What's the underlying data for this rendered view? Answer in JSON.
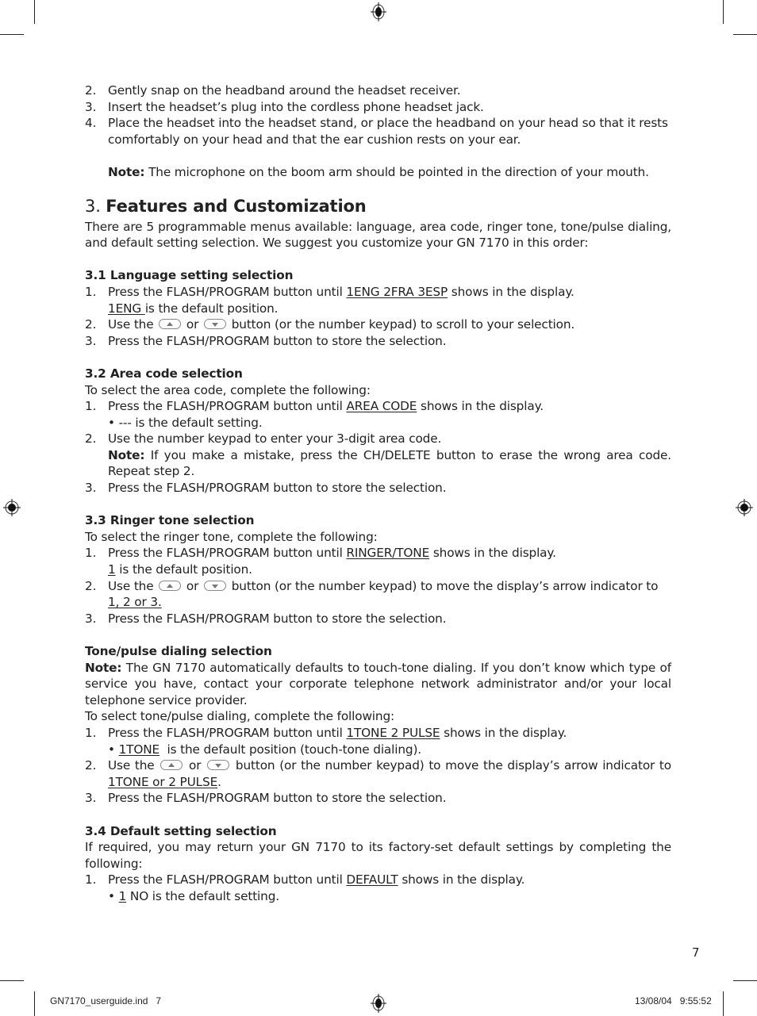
{
  "intro_list": [
    {
      "num": "2.",
      "text": "Gently snap on the headband around the headset receiver."
    },
    {
      "num": "3.",
      "text": "Insert the headset’s plug into the cordless phone headset jack."
    },
    {
      "num": "4.",
      "text": "Place the headset into the headset stand, or place the headband on your head so that it rests comfortably on your head and that the ear cushion rests on your ear."
    }
  ],
  "intro_note": {
    "label": "Note:",
    "text": " The microphone on the boom arm should be pointed in the direction of your mouth."
  },
  "section": {
    "number": "3.",
    "title": "Features and Customization",
    "intro": "There are 5 programmable menus available: language, area code, ringer tone, tone/pulse dialing, and default setting selection. We suggest you customize your GN 7170 in this order:"
  },
  "s31": {
    "title": "3.1 Language setting selection",
    "step1": {
      "num": "1.",
      "pre": "Press the FLASH/PROGRAM button until ",
      "u": "1ENG 2FRA 3ESP",
      "post": " shows in the display."
    },
    "step1_sub": {
      "u": "1ENG ",
      "post": "is the default position."
    },
    "step2": {
      "num": "2.",
      "pre": "Use the ",
      "or": " or ",
      "post": " button (or the number keypad) to scroll to your selection."
    },
    "step3": {
      "num": "3.",
      "text": "Press the FLASH/PROGRAM button to store the selection."
    }
  },
  "s32": {
    "title": "3.2 Area code selection",
    "intro": "To select the area code, complete the following:",
    "step1": {
      "num": "1.",
      "pre": "Press the FLASH/PROGRAM button until ",
      "u": "AREA CODE",
      "post": " shows in the display."
    },
    "step1_sub": "• --- is the default setting.",
    "step2": {
      "num": "2.",
      "text": "Use the number keypad to enter your 3-digit area code."
    },
    "step2_note": {
      "label": "Note:",
      "text": " If you make a mistake, press the CH/DELETE button to erase the wrong area code. Repeat step 2."
    },
    "step3": {
      "num": "3.",
      "text": "Press the FLASH/PROGRAM button to store the selection."
    }
  },
  "s33": {
    "title": "3.3 Ringer tone selection",
    "intro": "To select the ringer tone, complete the following:",
    "step1": {
      "num": "1.",
      "pre": "Press the FLASH/PROGRAM button until ",
      "u": "RINGER/TONE",
      "post": " shows in the display."
    },
    "step1_sub": {
      "u": "1",
      "post": " is the default position."
    },
    "step2": {
      "num": "2.",
      "pre": "Use the ",
      "or": " or ",
      "post": " button (or the number keypad) to move the display’s arrow indicator to ",
      "u": "1, 2 or 3."
    },
    "step3": {
      "num": "3.",
      "text": "Press the FLASH/PROGRAM button to store the selection."
    }
  },
  "tone": {
    "title": "Tone/pulse dialing selection",
    "note": {
      "label": "Note:",
      "text": " The GN 7170 automatically defaults to touch-tone dialing. If you don’t know which type of service you have, contact your corporate telephone network administrator and/or your local telephone service provider."
    },
    "intro": "To select tone/pulse dialing, complete the following:",
    "step1": {
      "num": "1.",
      "pre": "Press the FLASH/PROGRAM button until ",
      "u": "1TONE 2 PULSE",
      "post": " shows in the display."
    },
    "step1_sub": {
      "pre": "• ",
      "u": "1TONE",
      "post": "  is the default position (touch-tone dialing)."
    },
    "step2": {
      "num": "2.",
      "pre": "Use the ",
      "or": " or ",
      "post": " button (or the number keypad) to move the display’s arrow indicator to ",
      "u": "1TONE or 2 PULSE",
      "end": "."
    },
    "step3": {
      "num": "3.",
      "text": "Press the FLASH/PROGRAM button to store the selection."
    }
  },
  "s34": {
    "title": "3.4 Default setting selection",
    "intro": "If required, you may return your GN 7170 to its factory-set default settings by completing the following:",
    "step1": {
      "num": "1.",
      "pre": "Press the FLASH/PROGRAM button until ",
      "u": "DEFAULT",
      "post": " shows in the display."
    },
    "step1_sub": {
      "pre": "• ",
      "u": "1",
      "post": " NO is the default setting."
    }
  },
  "page_number": "7",
  "slug": {
    "file": "GN7170_userguide.ind   7",
    "timestamp": "13/08/04   9:55:52"
  },
  "icons": {
    "up": "up-arrow-button-icon",
    "down": "down-arrow-button-icon",
    "registration": "registration-mark-icon"
  }
}
